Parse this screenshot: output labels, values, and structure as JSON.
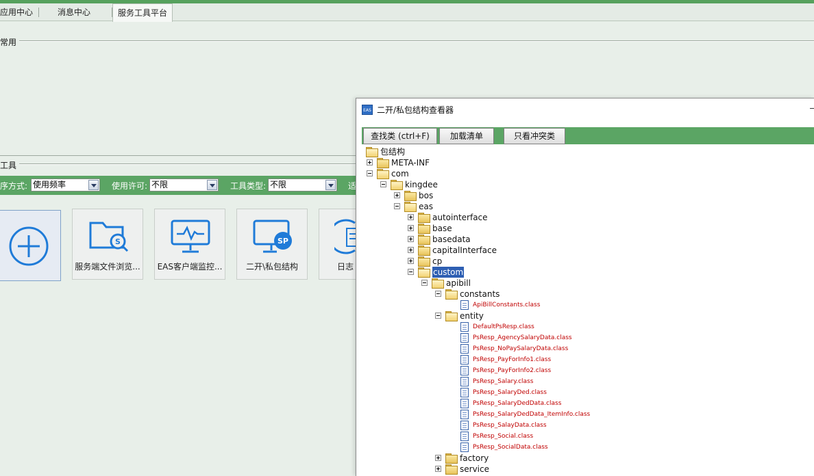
{
  "top_tabs": [
    {
      "label": "应用中心",
      "active": false
    },
    {
      "label": "消息中心",
      "active": false
    },
    {
      "label": "服务工具平台",
      "active": true
    }
  ],
  "sections": {
    "common": "常用",
    "tools": "工具"
  },
  "filters": {
    "sort_label": "序方式:",
    "sort_value": "使用频率",
    "license_label": "使用许可:",
    "license_value": "不限",
    "type_label": "工具类型:",
    "type_value": "不限",
    "trailing_label": "适"
  },
  "tool_cards": [
    {
      "label": "",
      "icon": "add-icon"
    },
    {
      "label": "服务端文件浏览...",
      "icon": "folder-search-icon"
    },
    {
      "label": "EAS客户端监控...",
      "icon": "monitor-pulse-icon"
    },
    {
      "label": "二开\\私包结构",
      "icon": "monitor-sp-icon"
    },
    {
      "label": "日志",
      "icon": "log-icon"
    }
  ],
  "dialog": {
    "icon_text": "EAS",
    "title": "二开/私包结构查看器",
    "buttons": {
      "find": "查找类 (ctrl+F)",
      "load": "加载清单",
      "conflict": "只看冲突类"
    }
  },
  "tree": [
    {
      "label": "包结构",
      "level": 0,
      "type": "folder",
      "expander": "none",
      "open": true
    },
    {
      "label": "META-INF",
      "level": 1,
      "type": "folder",
      "expander": "plus",
      "open": false
    },
    {
      "label": "com",
      "level": 1,
      "type": "folder",
      "expander": "minus",
      "open": true
    },
    {
      "label": "kingdee",
      "level": 2,
      "type": "folder",
      "expander": "minus",
      "open": true
    },
    {
      "label": "bos",
      "level": 3,
      "type": "folder",
      "expander": "plus",
      "open": false
    },
    {
      "label": "eas",
      "level": 3,
      "type": "folder",
      "expander": "minus",
      "open": true
    },
    {
      "label": "autointerface",
      "level": 4,
      "type": "folder",
      "expander": "plus",
      "open": false
    },
    {
      "label": "base",
      "level": 4,
      "type": "folder",
      "expander": "plus",
      "open": false
    },
    {
      "label": "basedata",
      "level": 4,
      "type": "folder",
      "expander": "plus",
      "open": false
    },
    {
      "label": "capitalInterface",
      "level": 4,
      "type": "folder",
      "expander": "plus",
      "open": false
    },
    {
      "label": "cp",
      "level": 4,
      "type": "folder",
      "expander": "plus",
      "open": false
    },
    {
      "label": "custom",
      "level": 4,
      "type": "folder",
      "expander": "minus",
      "open": true,
      "selected": true
    },
    {
      "label": "apibill",
      "level": 5,
      "type": "folder",
      "expander": "minus",
      "open": true
    },
    {
      "label": "constants",
      "level": 6,
      "type": "folder",
      "expander": "minus",
      "open": true
    },
    {
      "label": "ApiBillConstants.class",
      "level": 7,
      "type": "file"
    },
    {
      "label": "entity",
      "level": 6,
      "type": "folder",
      "expander": "minus",
      "open": true
    },
    {
      "label": "DefaultPsResp.class",
      "level": 7,
      "type": "file"
    },
    {
      "label": "PsResp_AgencySalaryData.class",
      "level": 7,
      "type": "file"
    },
    {
      "label": "PsResp_NoPaySalaryData.class",
      "level": 7,
      "type": "file"
    },
    {
      "label": "PsResp_PayForInfo1.class",
      "level": 7,
      "type": "file"
    },
    {
      "label": "PsResp_PayForInfo2.class",
      "level": 7,
      "type": "file"
    },
    {
      "label": "PsResp_Salary.class",
      "level": 7,
      "type": "file"
    },
    {
      "label": "PsResp_SalaryDed.class",
      "level": 7,
      "type": "file"
    },
    {
      "label": "PsResp_SalaryDedData.class",
      "level": 7,
      "type": "file"
    },
    {
      "label": "PsResp_SalaryDedData_ItemInfo.class",
      "level": 7,
      "type": "file"
    },
    {
      "label": "PsResp_SalayData.class",
      "level": 7,
      "type": "file"
    },
    {
      "label": "PsResp_Social.class",
      "level": 7,
      "type": "file"
    },
    {
      "label": "PsResp_SocialData.class",
      "level": 7,
      "type": "file"
    },
    {
      "label": "factory",
      "level": 6,
      "type": "folder",
      "expander": "plus",
      "open": false
    },
    {
      "label": "service",
      "level": 6,
      "type": "folder",
      "expander": "plus",
      "open": false
    }
  ],
  "colors": {
    "accent_green": "#5ba564",
    "background": "#e8efe9",
    "icon_blue": "#1f7bd8",
    "class_file_text": "#c00000",
    "selection": "#2e5fb3"
  }
}
